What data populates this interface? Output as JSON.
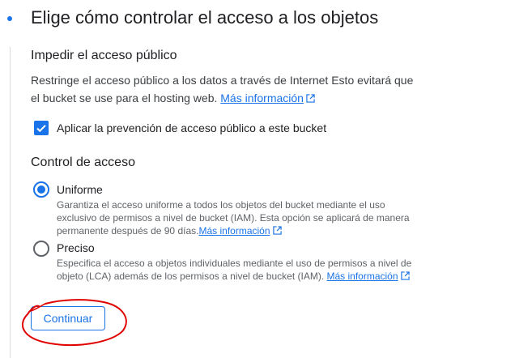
{
  "step": {
    "title": "Elige cómo controlar el acceso a los objetos"
  },
  "public_access": {
    "heading": "Impedir el acceso público",
    "description": "Restringe el acceso público a los datos a través de Internet Esto evitará que el bucket se use para el hosting web.",
    "learn_more": "Más información",
    "checkbox": {
      "label": "Aplicar la prevención de acceso público a este bucket",
      "checked": true
    }
  },
  "access_control": {
    "heading": "Control de acceso",
    "options": [
      {
        "label": "Uniforme",
        "selected": true,
        "description": "Garantiza el acceso uniforme a todos los objetos del bucket mediante el uso exclusivo de permisos a nivel de bucket (IAM). Esta opción se aplicará de manera permanente después de 90 días.",
        "learn_more": "Más información"
      },
      {
        "label": "Preciso",
        "selected": false,
        "description": "Especifica el acceso a objetos individuales mediante el uso de permisos a nivel de objeto (LCA) además de los permisos a nivel de bucket (IAM).",
        "learn_more": "Más información"
      }
    ]
  },
  "continue_button": {
    "label": "Continuar"
  },
  "colors": {
    "accent": "#1a73e8",
    "annotation": "#e00000",
    "text": "#202124",
    "secondary_text": "#5f6368"
  }
}
